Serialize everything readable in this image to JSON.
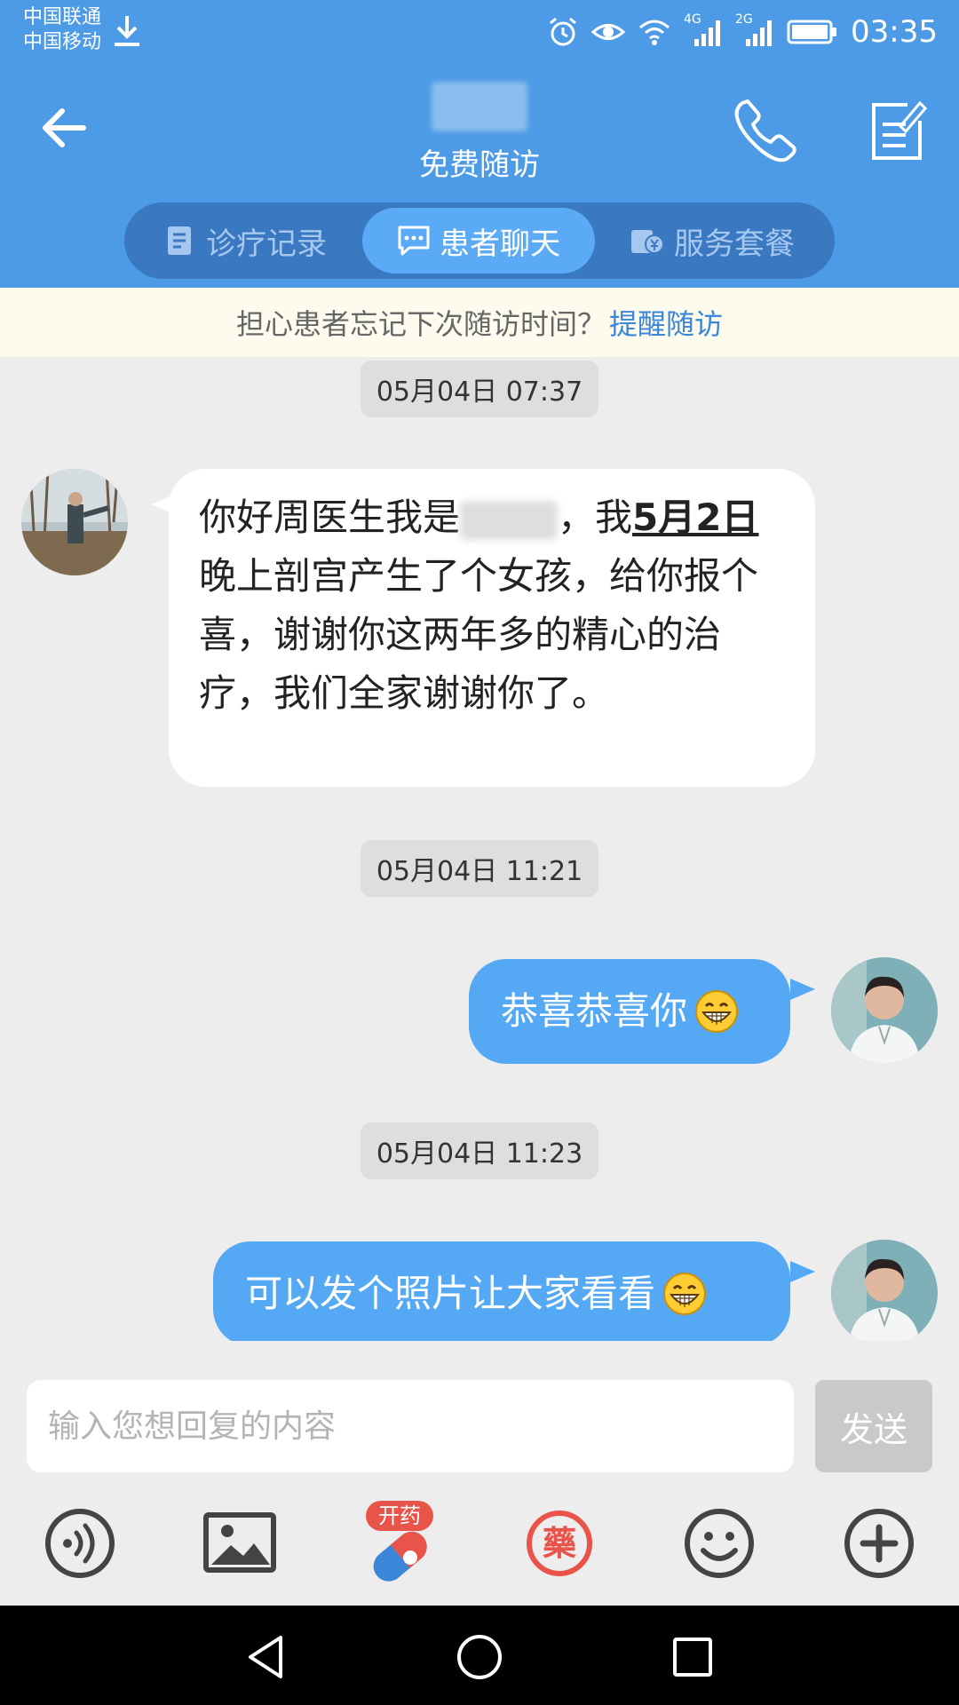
{
  "status_bar": {
    "carrier_1": "中国联通",
    "carrier_2": "中国移动",
    "net_4g": "4G",
    "net_2g": "2G",
    "time": "03:35"
  },
  "header": {
    "subtitle": "免费随访"
  },
  "tabs": [
    {
      "label": "诊疗记录",
      "active": false,
      "icon": "record-icon"
    },
    {
      "label": "患者聊天",
      "active": true,
      "icon": "chat-icon"
    },
    {
      "label": "服务套餐",
      "active": false,
      "icon": "package-icon"
    }
  ],
  "banner": {
    "text": "担心患者忘记下次随访时间？",
    "link": "提醒随访"
  },
  "messages": [
    {
      "type": "timestamp",
      "text": "05月04日 07:37"
    },
    {
      "type": "incoming",
      "part1": "你好周医生我是",
      "part2": "，我",
      "highlight": "5月2日",
      "part3": "晚上剖宫产生了个女孩，给你报个喜，谢谢你这两年多的精心的治疗，我们全家谢谢你了。"
    },
    {
      "type": "timestamp",
      "text": "05月04日 11:21"
    },
    {
      "type": "outgoing",
      "text": "恭喜恭喜你",
      "emoji": "grin-emoji"
    },
    {
      "type": "timestamp",
      "text": "05月04日 11:23"
    },
    {
      "type": "outgoing",
      "text": "可以发个照片让大家看看",
      "emoji": "grin-emoji"
    }
  ],
  "input": {
    "placeholder": "输入您想回复的内容",
    "send_label": "发送"
  },
  "tools": {
    "prescribe_badge": "开药",
    "medicine_glyph": "藥"
  },
  "colors": {
    "header_blue": "#4d9be6",
    "bubble_blue": "#55a8f3",
    "link_blue": "#3b86d9",
    "tool_red": "#e8534a"
  }
}
